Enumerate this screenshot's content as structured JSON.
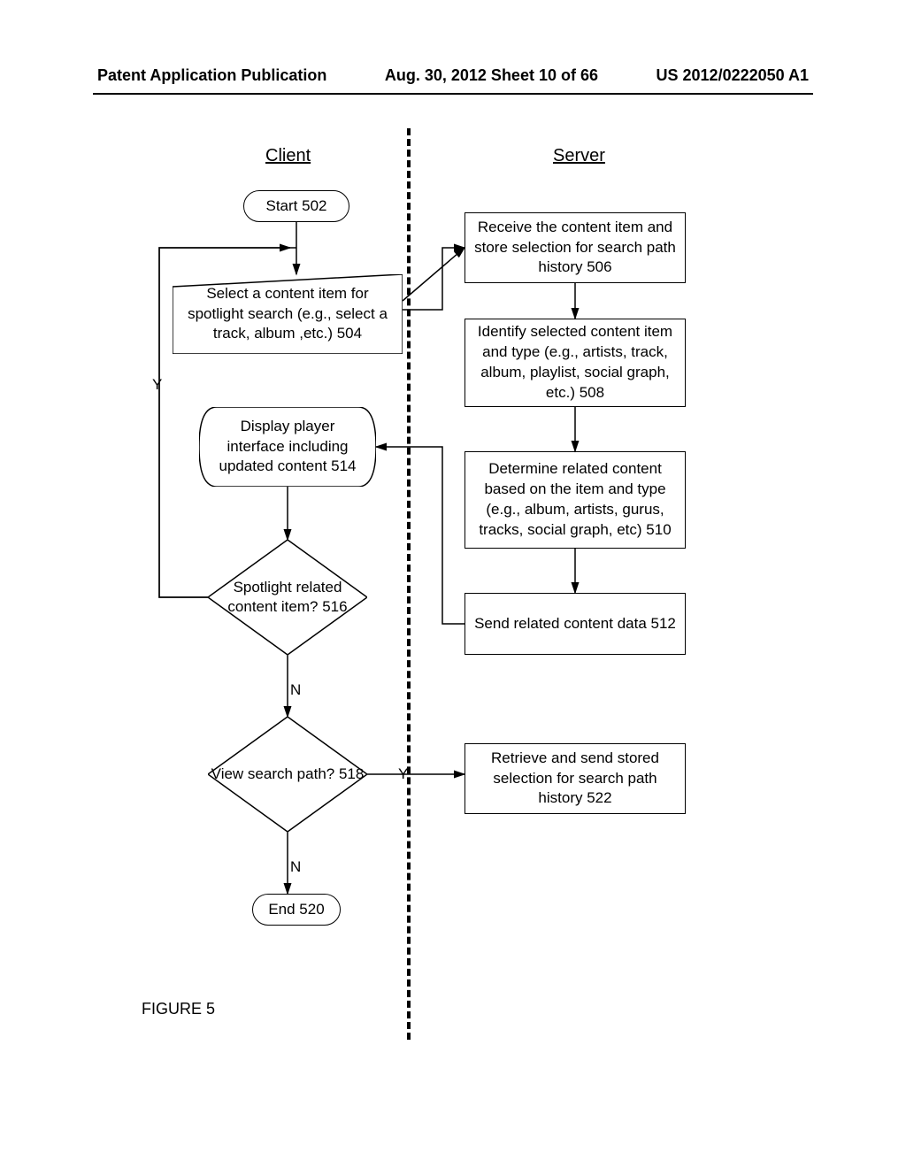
{
  "header": {
    "left": "Patent Application Publication",
    "center": "Aug. 30, 2012  Sheet 10 of 66",
    "right": "US 2012/0222050 A1"
  },
  "columns": {
    "client": "Client",
    "server": "Server"
  },
  "nodes": {
    "start": "Start 502",
    "select": "Select a content item for spotlight search (e.g., select a track, album ,etc.) 504",
    "s_recv": "Receive the content item and store selection for search path history  506",
    "s_ident": "Identify selected content item and type (e.g., artists, track, album, playlist, social graph, etc.) 508",
    "s_determine": "Determine related content based on the item and type (e.g., album, artists, gurus, tracks, social graph, etc)  510",
    "s_send": "Send related content data 512",
    "display": "Display player interface including updated content 514",
    "d_spot": "Spotlight related content item? 516",
    "d_view": "View search path? 518",
    "s_retrieve": "Retrieve and send stored selection for search path history 522",
    "end": "End 520"
  },
  "labels": {
    "y": "Y",
    "n": "N"
  },
  "figure": "FIGURE 5"
}
